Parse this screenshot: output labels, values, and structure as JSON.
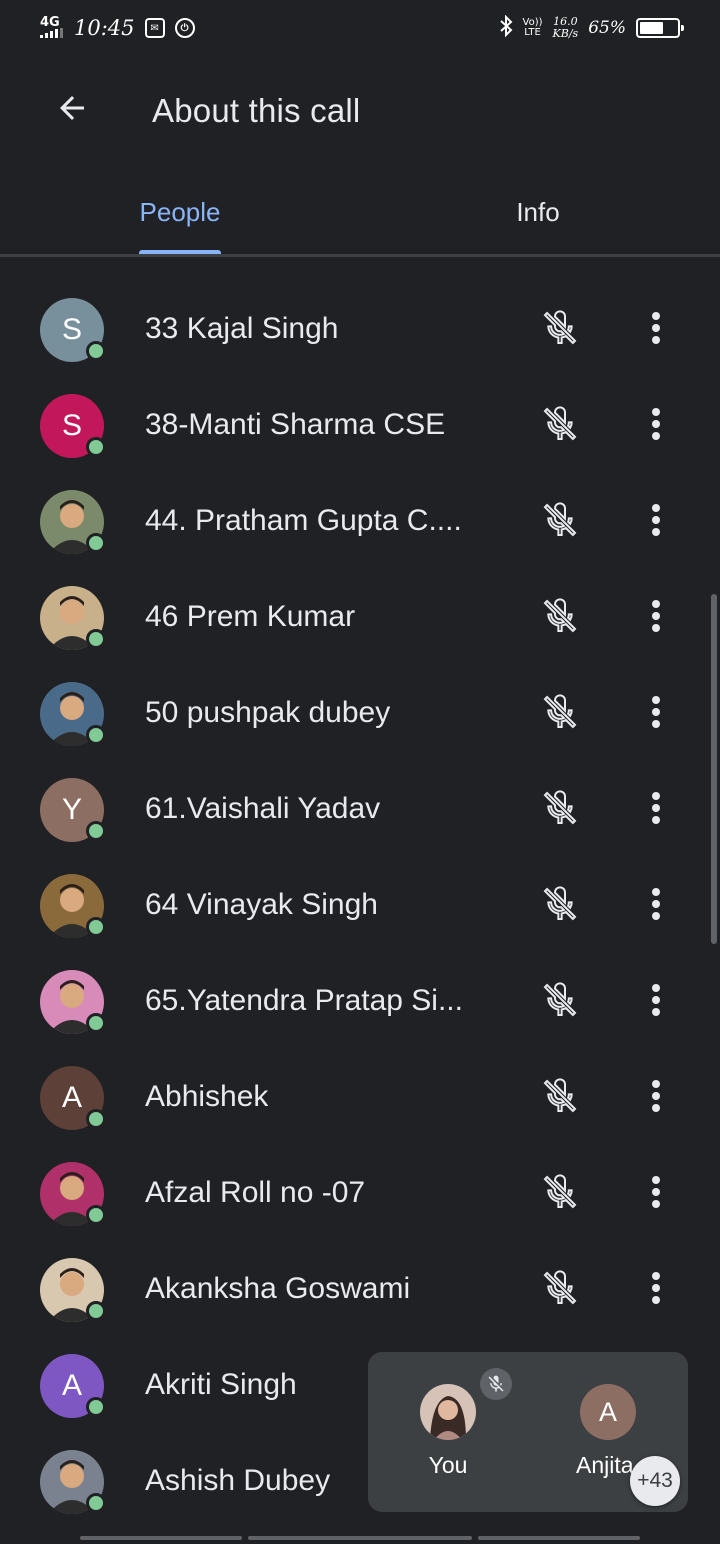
{
  "status_bar": {
    "network": "4G",
    "time": "10:45",
    "volte_top": "Vo))",
    "volte_bottom": "LTE",
    "speed_value": "16.0",
    "speed_unit": "KB/s",
    "battery_percent": "65%",
    "battery_level": 0.65
  },
  "header": {
    "title": "About this call",
    "back_icon": "arrow-left-icon"
  },
  "tabs": [
    {
      "label": "People",
      "selected": true
    },
    {
      "label": "Info",
      "selected": false
    }
  ],
  "colors": {
    "background": "#202124",
    "accent": "#8ab4f8",
    "online": "#81c995",
    "tile": "#3c4043"
  },
  "participants": [
    {
      "name": "33 Kajal Singh",
      "initial": "S",
      "avatar_color": "#78909c",
      "photo": false,
      "muted": true
    },
    {
      "name": "38-Manti Sharma CSE",
      "initial": "S",
      "avatar_color": "#c2185b",
      "photo": false,
      "muted": true
    },
    {
      "name": "44. Pratham Gupta C....",
      "initial": "",
      "avatar_color": "#7a8a6a",
      "photo": true,
      "muted": true
    },
    {
      "name": "46 Prem Kumar",
      "initial": "",
      "avatar_color": "#c8b08a",
      "photo": true,
      "muted": true
    },
    {
      "name": "50 pushpak dubey",
      "initial": "",
      "avatar_color": "#4a6a8a",
      "photo": true,
      "muted": true
    },
    {
      "name": "61.Vaishali Yadav",
      "initial": "Y",
      "avatar_color": "#8d6e63",
      "photo": false,
      "muted": true
    },
    {
      "name": "64 Vinayak Singh",
      "initial": "",
      "avatar_color": "#8a6a3a",
      "photo": true,
      "muted": true
    },
    {
      "name": "65.Yatendra Pratap Si...",
      "initial": "",
      "avatar_color": "#d88ab8",
      "photo": true,
      "muted": true
    },
    {
      "name": "Abhishek",
      "initial": "A",
      "avatar_color": "#5d4037",
      "photo": false,
      "muted": true
    },
    {
      "name": "Afzal Roll no -07",
      "initial": "",
      "avatar_color": "#b0306a",
      "photo": true,
      "muted": true
    },
    {
      "name": "Akanksha Goswami",
      "initial": "",
      "avatar_color": "#d8c8b0",
      "photo": true,
      "muted": true
    },
    {
      "name": "Akriti Singh",
      "initial": "A",
      "avatar_color": "#7e57c2",
      "photo": false,
      "muted": false
    },
    {
      "name": "Ashish Dubey",
      "initial": "",
      "avatar_color": "#7a8290",
      "photo": true,
      "muted": false
    }
  ],
  "mini_tile": {
    "you_label": "You",
    "other_initial": "A",
    "other_label": "Anjita",
    "more_count": "+43"
  }
}
